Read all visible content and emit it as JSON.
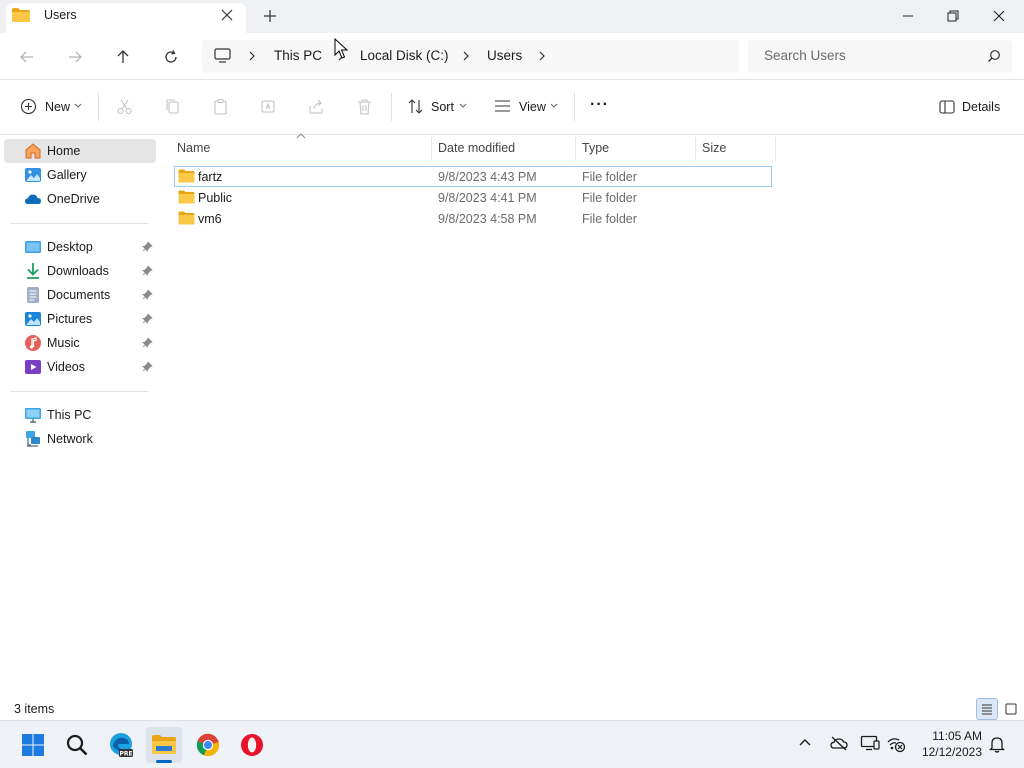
{
  "window": {
    "tab_title": "Users",
    "tab_icon": "folder-icon",
    "new_tab": "+",
    "controls": [
      "minimize-icon",
      "restore-icon",
      "close-icon"
    ]
  },
  "nav": {
    "back": "arrow-left-icon",
    "forward": "arrow-right-icon",
    "up": "arrow-up-icon",
    "refresh": "refresh-icon"
  },
  "breadcrumb": {
    "root_icon": "monitor-icon",
    "items": [
      "This PC",
      "Local Disk (C:)",
      "Users"
    ]
  },
  "search": {
    "placeholder": "Search Users"
  },
  "toolbar": {
    "new_label": "New",
    "sort_label": "Sort",
    "view_label": "View",
    "more_label": "···",
    "details_label": "Details",
    "disabled_actions": [
      "cut-icon",
      "copy-icon",
      "paste-icon",
      "rename-icon",
      "share-icon",
      "delete-icon"
    ]
  },
  "sidebar": {
    "top": [
      {
        "label": "Home",
        "icon": "home-icon",
        "selected": true
      },
      {
        "label": "Gallery",
        "icon": "gallery-icon"
      },
      {
        "label": "OneDrive",
        "icon": "onedrive-icon"
      }
    ],
    "quick": [
      {
        "label": "Desktop",
        "icon": "desktop-icon"
      },
      {
        "label": "Downloads",
        "icon": "download-icon"
      },
      {
        "label": "Documents",
        "icon": "documents-icon"
      },
      {
        "label": "Pictures",
        "icon": "pictures-icon"
      },
      {
        "label": "Music",
        "icon": "music-icon"
      },
      {
        "label": "Videos",
        "icon": "videos-icon"
      }
    ],
    "bottom": [
      {
        "label": "This PC",
        "icon": "this-pc-icon"
      },
      {
        "label": "Network",
        "icon": "network-icon"
      }
    ]
  },
  "columns": {
    "name": "Name",
    "date": "Date modified",
    "type": "Type",
    "size": "Size"
  },
  "files": [
    {
      "name": "fartz",
      "date": "9/8/2023 4:43 PM",
      "type": "File folder",
      "size": ""
    },
    {
      "name": "Public",
      "date": "9/8/2023 4:41 PM",
      "type": "File folder",
      "size": ""
    },
    {
      "name": "vm6",
      "date": "9/8/2023 4:58 PM",
      "type": "File folder",
      "size": ""
    }
  ],
  "status": {
    "items_count": "3 items"
  },
  "taskbar": {
    "apps": [
      "windows-start-icon",
      "search-icon",
      "edge-preview-icon",
      "file-explorer-icon",
      "chrome-icon",
      "opera-icon"
    ],
    "tray": [
      "chevron-up-icon",
      "onedrive-offline-icon",
      "display-icon",
      "network-disconnected-icon",
      "notification-bell-icon"
    ],
    "time": "11:05 AM",
    "date": "12/12/2023"
  },
  "colors": {
    "accent": "#0067c0",
    "folder": "#f8c846",
    "folder_dark": "#e8a617",
    "selection_border": "#99c9ef",
    "sidebar_selected": "#e5e5e5"
  }
}
